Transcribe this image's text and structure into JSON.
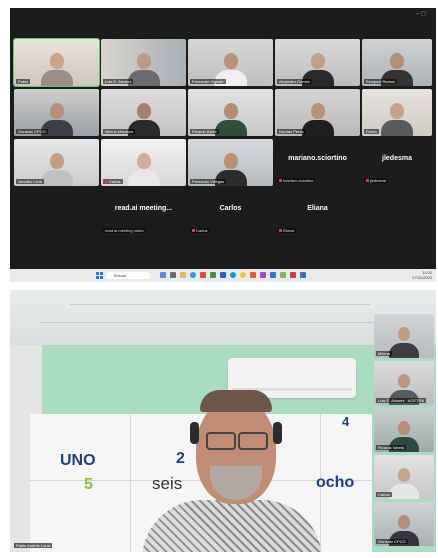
{
  "gallery": {
    "tiles": [
      {
        "label": "Pablo",
        "active": true
      },
      {
        "label": "Luis E. Alvarez"
      },
      {
        "label": "Fernando Vignale"
      },
      {
        "label": "Alejandro Gomez"
      },
      {
        "label": "Ezequiel Ramos"
      },
      {
        "label": "Gonzalo CPCO"
      },
      {
        "label": "Milena Marasco"
      },
      {
        "label": "Ricardo Barre"
      },
      {
        "label": "Nicolas Perez"
      },
      {
        "label": "Flavia"
      },
      {
        "label": "Jennifer Lima"
      },
      {
        "label": "Carlos"
      },
      {
        "label": "Fernando Villegas"
      }
    ],
    "name_tiles": [
      {
        "big": "mariano.sciortino",
        "label": "mariano.sciortino"
      },
      {
        "big": "jledesma",
        "label": "jledesma"
      },
      {
        "big": "read.ai meeting...",
        "label": "read.ai meeting notes"
      },
      {
        "big": "Carlos",
        "label": "Carlos"
      },
      {
        "big": "Eliana",
        "label": "Eliana"
      }
    ],
    "window_controls": "–  ◻",
    "taskbar": {
      "search_placeholder": "Buscar",
      "tray_text": "∧  ⊡  ⊕  ⟡  ESP\nLAA  ⊙  ⊲  ⊏",
      "time": "11:02",
      "date": "27/11/2023"
    }
  },
  "speaker_view": {
    "speaker_label": "Pablo Andrés Luna",
    "board_words": {
      "uno": "UNO",
      "two": "2",
      "four": "4",
      "five": "5",
      "seis": "seis",
      "ocho": "ocho"
    },
    "side_tiles": [
      {
        "label": "Milena"
      },
      {
        "label": "Luis E. Alvarez · ACETRA"
      },
      {
        "label": "Ricardo Varela"
      },
      {
        "label": "Carlos"
      },
      {
        "label": "Gonzalo CPCO"
      }
    ]
  },
  "colors": {
    "board_blue": "#1f3f8a",
    "board_green": "#8fbf3f",
    "active_border": "#53d36b",
    "muted_red": "#e03b3b"
  }
}
